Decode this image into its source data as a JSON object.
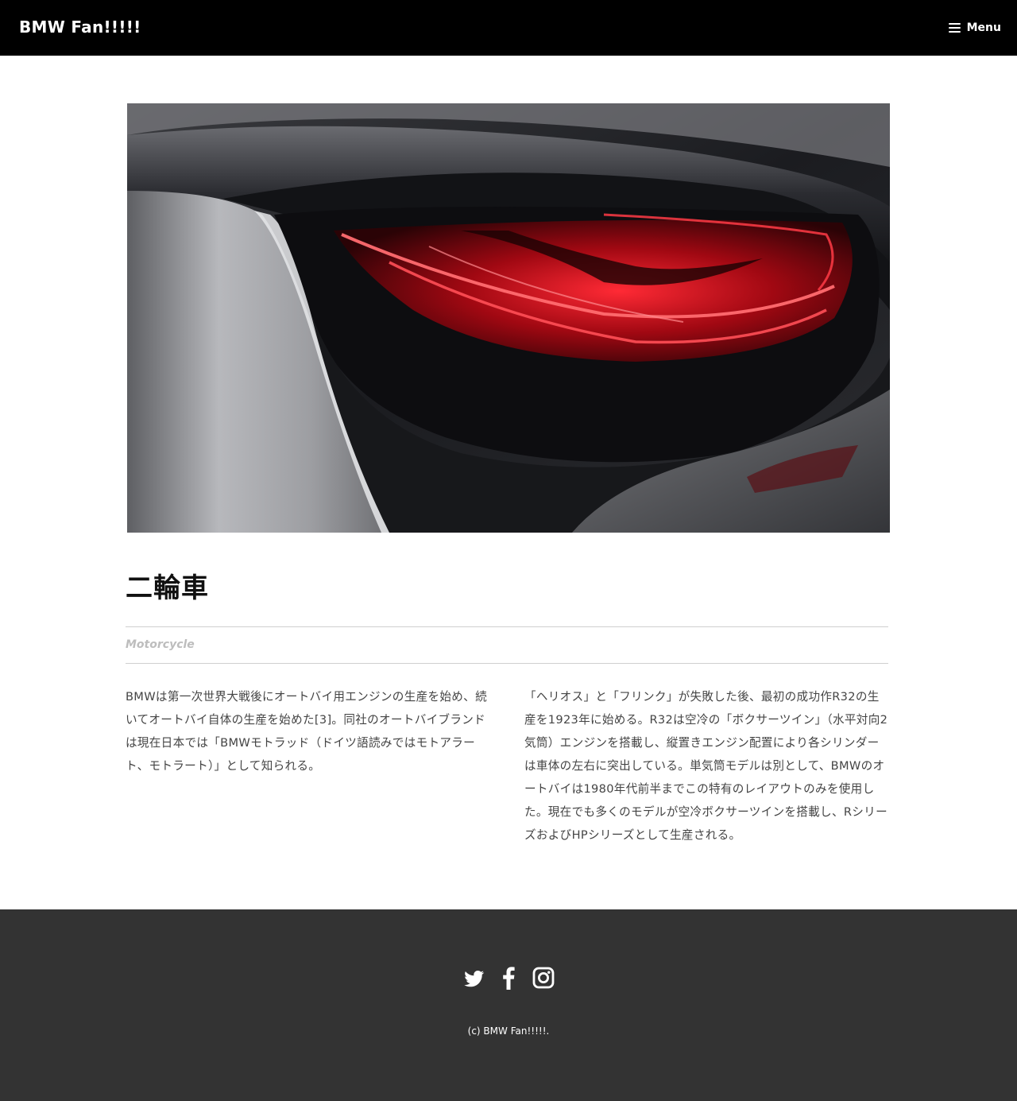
{
  "header": {
    "site_title": "BMW Fan!!!!!",
    "menu_label": "Menu"
  },
  "hero": {
    "icon": "car-taillight-photo"
  },
  "article": {
    "title": "二輪車",
    "category": "Motorcycle",
    "paragraph_left": "BMWは第一次世界大戦後にオートバイ用エンジンの生産を始め、続いてオートバイ自体の生産を始めた[3]。同社のオートバイブランドは現在日本では「BMWモトラッド（ドイツ語読みではモトアラート、モトラート）」として知られる。",
    "paragraph_right": "「ヘリオス」と「フリンク」が失敗した後、最初の成功作R32の生産を1923年に始める。R32は空冷の「ボクサーツイン」（水平対向2気筒）エンジンを搭載し、縦置きエンジン配置により各シリンダーは車体の左右に突出している。単気筒モデルは別として、BMWのオートバイは1980年代前半までこの特有のレイアウトのみを使用した。現在でも多くのモデルが空冷ボクサーツインを搭載し、RシリーズおよびHPシリーズとして生産される。"
  },
  "footer": {
    "social": [
      "twitter-icon",
      "facebook-icon",
      "instagram-icon"
    ],
    "copyright": "(c) BMW Fan!!!!!."
  },
  "colors": {
    "header_bg": "#000000",
    "footer_bg": "#333333",
    "taillight_red": "#d8101e"
  }
}
